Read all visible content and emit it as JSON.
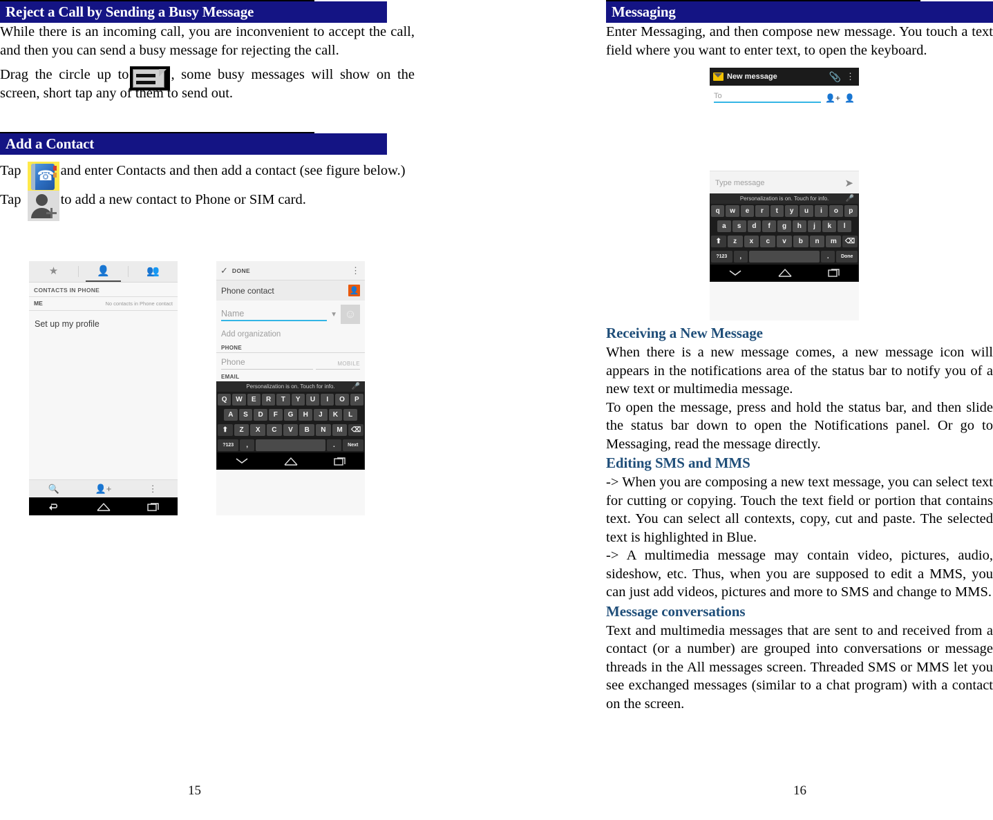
{
  "document": {
    "type": "mobile-phone-user-manual",
    "accent_navy": "#141484",
    "accent_heading_blue": "#1F4E79"
  },
  "left_page": {
    "page_number": "15",
    "section1": {
      "heading": "Reject a Call by Sending a Busy Message",
      "paragraph1": "While there is an incoming call, you are inconvenient to accept the call, and then you can send a busy message for rejecting the call.",
      "paragraph2_before": "Drag the circle up to",
      "paragraph2_after": ", some busy messages will show on the screen, short tap any of them to send out.",
      "icon": "busy-message-icon"
    },
    "section2": {
      "heading": "Add a Contact",
      "paragraph1_before": "Tap",
      "paragraph1_after": "and enter Contacts and then add a contact (see figure below.)",
      "icon1": "contacts-book-icon",
      "paragraph2_before": "Tap",
      "paragraph2_after": "to add a new contact to Phone or SIM card.",
      "icon2": "add-person-icon"
    },
    "figure_contacts": {
      "tabs": [
        {
          "name": "favorites-tab",
          "icon": "star-icon",
          "active": false
        },
        {
          "name": "contacts-tab",
          "icon": "person-icon",
          "active": true
        },
        {
          "name": "groups-tab",
          "icon": "group-icon",
          "active": false
        }
      ],
      "section_label": "CONTACTS IN PHONE",
      "me_label": "ME",
      "me_note": "No contacts in Phone contact",
      "profile_row": "Set up my profile",
      "bottom_actions": [
        {
          "name": "search-action",
          "icon": "search-icon"
        },
        {
          "name": "add-contact-action",
          "icon": "add-person-icon"
        },
        {
          "name": "more-options-action",
          "icon": "kebab-icon"
        }
      ],
      "nav": [
        {
          "name": "back-nav",
          "icon": "back-arrow-icon"
        },
        {
          "name": "home-nav",
          "icon": "home-icon"
        },
        {
          "name": "recents-nav",
          "icon": "recents-icon"
        }
      ]
    },
    "figure_addcontact": {
      "done_label": "DONE",
      "kebab": "⋮",
      "account_name": "Phone contact",
      "account_badge_icon": "contact-badge-icon",
      "name_placeholder": "Name",
      "photo_icon": "photo-placeholder-icon",
      "organization_placeholder": "Add organization",
      "phone_category": "PHONE",
      "phone_placeholder": "Phone",
      "phone_type": "MOBILE",
      "email_category": "EMAIL",
      "keyboard": {
        "hint": "Personalization is on. Touch for info.",
        "mic_icon": "microphone-icon",
        "row1": [
          "Q",
          "W",
          "E",
          "R",
          "T",
          "Y",
          "U",
          "I",
          "O",
          "P"
        ],
        "row2": [
          "A",
          "S",
          "D",
          "F",
          "G",
          "H",
          "J",
          "K",
          "L"
        ],
        "row3_shift": "⬆",
        "row3": [
          "Z",
          "X",
          "C",
          "V",
          "B",
          "N",
          "M"
        ],
        "row3_backspace": "⌫",
        "row4_symbols": "?123",
        "row4_comma": ",",
        "row4_space": "",
        "row4_period": ".",
        "row4_action": "Next"
      },
      "nav": [
        {
          "name": "hide-keyboard-nav",
          "icon": "chevron-down-icon"
        },
        {
          "name": "home-nav",
          "icon": "home-icon"
        },
        {
          "name": "recents-nav",
          "icon": "recents-icon"
        }
      ]
    }
  },
  "right_page": {
    "page_number": "16",
    "section_messaging": {
      "heading": "Messaging",
      "paragraph1": "Enter Messaging, and then compose new message. You touch a text field where you want to enter text, to open the keyboard."
    },
    "figure_newmessage": {
      "title": "New message",
      "mail_icon": "mail-icon",
      "attach_icon": "paperclip-icon",
      "kebab": "⋮",
      "to_placeholder": "To",
      "contact_picker_icons": [
        "add-person-icon",
        "person-icon"
      ],
      "compose_placeholder": "Type message",
      "send_icon": "send-icon",
      "keyboard": {
        "hint": "Personalization is on. Touch for info.",
        "mic_icon": "microphone-icon",
        "row1": [
          "q",
          "w",
          "e",
          "r",
          "t",
          "y",
          "u",
          "i",
          "o",
          "p"
        ],
        "row2": [
          "a",
          "s",
          "d",
          "f",
          "g",
          "h",
          "j",
          "k",
          "l"
        ],
        "row3_shift": "⬆",
        "row3": [
          "z",
          "x",
          "c",
          "v",
          "b",
          "n",
          "m"
        ],
        "row3_backspace": "⌫",
        "row4_symbols": "?123",
        "row4_comma": ",",
        "row4_space": "",
        "row4_period": ".",
        "row4_action": "Done"
      },
      "nav": [
        {
          "name": "hide-keyboard-nav",
          "icon": "chevron-down-icon"
        },
        {
          "name": "home-nav",
          "icon": "home-icon"
        },
        {
          "name": "recents-nav",
          "icon": "recents-icon"
        }
      ]
    },
    "sub_receiving": {
      "heading": "Receiving a New Message",
      "paragraph1": "When there is a new message comes, a new message icon will appears in the notifications area of the status bar to notify you of a new text or multimedia message.",
      "paragraph2": "To open the message, press and hold the status bar, and then slide the status bar down to open the Notifications panel. Or go to Messaging, read the message directly."
    },
    "sub_editing": {
      "heading": "Editing SMS and MMS",
      "paragraph1": "-> When you are composing a new text message, you can select text for cutting or copying. Touch the text field or portion that contains text. You can select all contexts, copy, cut and paste. The selected text is highlighted in Blue.",
      "paragraph2": "-> A multimedia message may contain video, pictures, audio, sideshow, etc. Thus, when you are supposed to edit a MMS, you can just add videos, pictures and more to SMS and change to MMS."
    },
    "sub_conversations": {
      "heading": "Message conversations",
      "paragraph1": "Text and multimedia messages that are sent to and received from a contact (or a number) are grouped into conversations or message threads in the All messages screen. Threaded SMS or MMS let you see exchanged messages (similar to a chat program) with a contact on the screen."
    }
  }
}
